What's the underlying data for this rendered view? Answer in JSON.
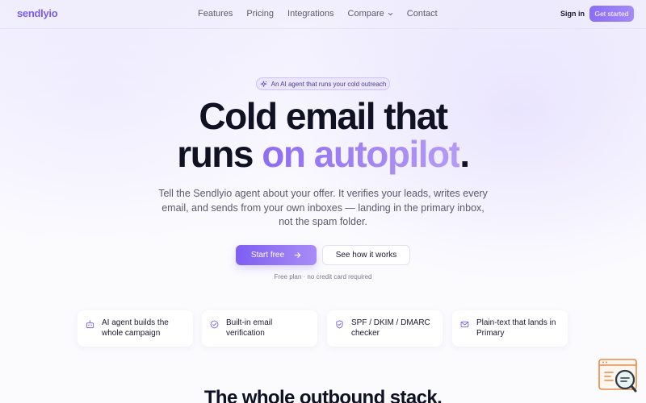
{
  "brand": {
    "name": "sendlyio",
    "accent": "#7b5cf0"
  },
  "nav": {
    "links": [
      "Features",
      "Pricing",
      "Integrations",
      "Compare",
      "Contact"
    ],
    "signin": "Sign in",
    "cta": "Get started"
  },
  "hero": {
    "pill": "An AI agent that runs your cold outreach",
    "pill_icon": "sparkles-icon",
    "headline_line1": "Cold email that",
    "headline_line2_pre": "runs ",
    "headline_line2_accent": "on autopilot",
    "headline_line2_post": ".",
    "subtext": "Tell the Sendlyio agent about your offer. It verifies your leads, writes every email, and sends from your own inboxes — landing in the primary inbox, not the spam folder.",
    "primary_button": "Start free",
    "secondary_button": "See how it works",
    "fineprint": "Free plan · no credit card required"
  },
  "features": [
    {
      "icon": "robot-icon",
      "label": "AI agent builds the whole campaign"
    },
    {
      "icon": "check-circle-icon",
      "label": "Built-in email verification"
    },
    {
      "icon": "shield-check-icon",
      "label": "SPF / DKIM / DMARC checker"
    },
    {
      "icon": "mail-icon",
      "label": "Plain-text that lands in Primary"
    }
  ],
  "section_heading": "The whole outbound stack.",
  "widget": {
    "icon": "chat-search-icon"
  }
}
